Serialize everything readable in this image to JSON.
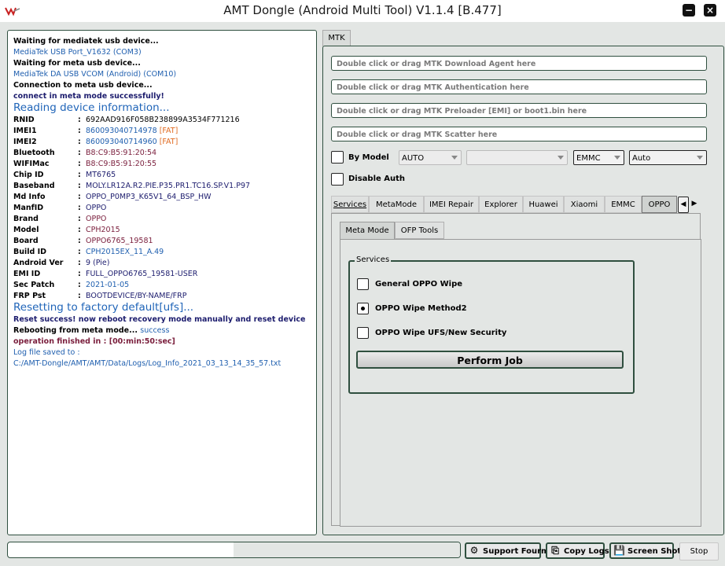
{
  "window": {
    "title": "AMT Dongle (Android Multi Tool) V1.1.4 [B.477]"
  },
  "log": {
    "lines": [
      "Waiting for mediatek usb device...",
      "MediaTek USB Port_V1632 (COM3)",
      "Waiting for meta usb device...",
      "MediaTek DA USB VCOM (Android) (COM10)",
      "Connection to meta usb device...",
      "connect in meta mode successfully!",
      "Reading device information..."
    ],
    "info": [
      {
        "key": "RNID",
        "value": "692AAD916F058B238899A3534F771216"
      },
      {
        "key": "IMEI1",
        "value": "860093040714978",
        "tag": "[FAT]"
      },
      {
        "key": "IMEI2",
        "value": "860093040714960",
        "tag": "[FAT]"
      },
      {
        "key": "Bluetooth",
        "value": "B8:C9:B5:91:20:54"
      },
      {
        "key": "WIFIMac",
        "value": "B8:C9:B5:91:20:55"
      },
      {
        "key": "Chip ID",
        "value": "MT6765"
      },
      {
        "key": "Baseband",
        "value": "MOLY.LR12A.R2.PIE.P35.PR1.TC16.SP.V1.P97"
      },
      {
        "key": "Md Info",
        "value": "OPPO_P0MP3_K65V1_64_BSP_HW"
      },
      {
        "key": "ManfID",
        "value": "OPPO"
      },
      {
        "key": "Brand",
        "value": "OPPO"
      },
      {
        "key": "Model",
        "value": "CPH2015"
      },
      {
        "key": "Board",
        "value": "OPPO6765_19581"
      },
      {
        "key": "Build ID",
        "value": "CPH2015EX_11_A.49"
      },
      {
        "key": "Android Ver",
        "value": "9 (Pie)"
      },
      {
        "key": "EMI ID",
        "value": "FULL_OPPO6765_19581-USER"
      },
      {
        "key": "Sec Patch",
        "value": "2021-01-05"
      },
      {
        "key": "FRP Pst",
        "value": "BOOTDEVICE/BY-NAME/FRP"
      }
    ],
    "reset_head": "Resetting to factory default[ufs]...",
    "reset_success": "Reset success! now reboot recovery mode manually and reset device",
    "rebooting": "Rebooting from meta mode...",
    "rebooting_status": "success",
    "finished": "operation finished in : [00:min:50:sec]",
    "log_saved": "Log file saved to :",
    "log_path": "C:/AMT-Dongle/AMT/AMT/Data/Logs/Log_Info_2021_03_13_14_35_57.txt"
  },
  "mtk": {
    "tab_label": "MTK",
    "fields": [
      "Double click or drag MTK Download Agent here",
      "Double click or drag MTK Authentication here",
      "Double click or drag MTK Preloader [EMI] or boot1.bin here",
      "Double click or drag MTK Scatter here"
    ],
    "by_model_label": "By Model",
    "model_select": "AUTO",
    "second_select": "",
    "storage_select": "EMMC",
    "mode_select": "Auto",
    "disable_auth_label": "Disable Auth"
  },
  "tabs": [
    "Services",
    "MetaMode",
    "IMEI Repair",
    "Explorer",
    "Huawei",
    "Xiaomi",
    "EMMC",
    "OPPO"
  ],
  "active_tab": "OPPO",
  "subtabs": [
    "Meta Mode",
    "OFP Tools"
  ],
  "services": {
    "group_label": "Services",
    "options": [
      "General OPPO Wipe",
      "OPPO Wipe Method2",
      "OPPO Wipe UFS/New Security"
    ],
    "selected": "OPPO Wipe Method2",
    "perform_label": "Perform Job"
  },
  "footer": {
    "progress": 0.5,
    "support_label": "Support Fourm",
    "copy_logs_label": "Copy Logs",
    "screenshot_label": "Screen Shot",
    "stop_label": "Stop"
  }
}
